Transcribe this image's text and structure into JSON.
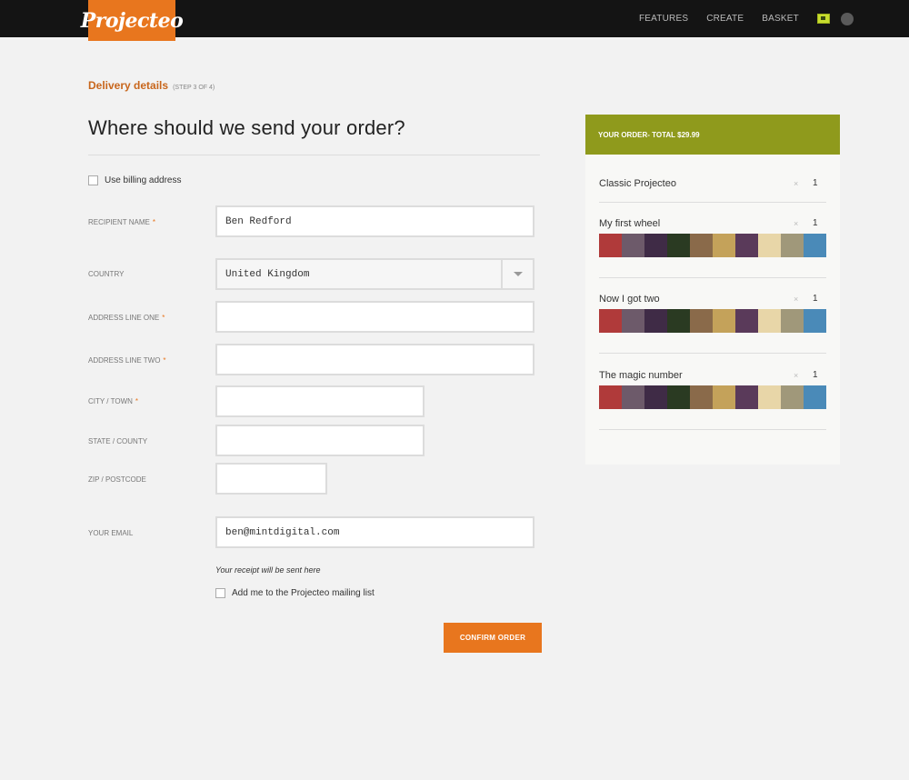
{
  "header": {
    "logo": "Projecteo",
    "nav": [
      "FEATURES",
      "CREATE",
      "BASKET"
    ],
    "icons": [
      "photo-icon",
      "user-avatar"
    ]
  },
  "step": {
    "title": "Delivery details",
    "sub": "(STEP 3 OF 4)"
  },
  "page_title": "Where should we send your order?",
  "billing": {
    "label": "Use billing address",
    "checked": false
  },
  "form": {
    "recipient_label": "RECIPIENT NAME",
    "recipient_value": "Ben Redford",
    "country_label": "COUNTRY",
    "country_value": "United Kingdom",
    "addr1_label": "ADDRESS LINE ONE",
    "addr1_value": "",
    "addr2_label": "ADDRESS LINE TWO",
    "addr2_value": "",
    "city_label": "CITY / TOWN",
    "city_value": "",
    "state_label": "STATE / COUNTY",
    "state_value": "",
    "zip_label": "ZIP / POSTCODE",
    "zip_value": "",
    "email_label": "YOUR EMAIL",
    "email_value": "ben@mintdigital.com",
    "required_mark": "*"
  },
  "receipt_note": "Your receipt will be sent here",
  "mailing": {
    "label": "Add me to the Projecteo mailing list",
    "checked": false
  },
  "confirm_label": "CONFIRM ORDER",
  "order": {
    "header_prefix": "YOUR ORDER",
    "header_total": " - TOTAL $29.99",
    "items": [
      {
        "name": "Classic Projecteo",
        "x": "×",
        "qty": "1"
      },
      {
        "name": "My first wheel",
        "x": "×",
        "qty": "1"
      },
      {
        "name": "Now I got two",
        "x": "×",
        "qty": "1"
      },
      {
        "name": "The magic number",
        "x": "×",
        "qty": "1"
      }
    ]
  },
  "colors": {
    "accent": "#e8761e",
    "order_header": "#8f9a1c",
    "topbar": "#141414"
  },
  "thumb_colors": [
    "#b03a3a",
    "#6d5a6a",
    "#3f2b46",
    "#2a3a22",
    "#8a6a4a",
    "#c4a25a",
    "#5a3a5a",
    "#e8d6a8",
    "#a0987a",
    "#4a8ab8"
  ]
}
